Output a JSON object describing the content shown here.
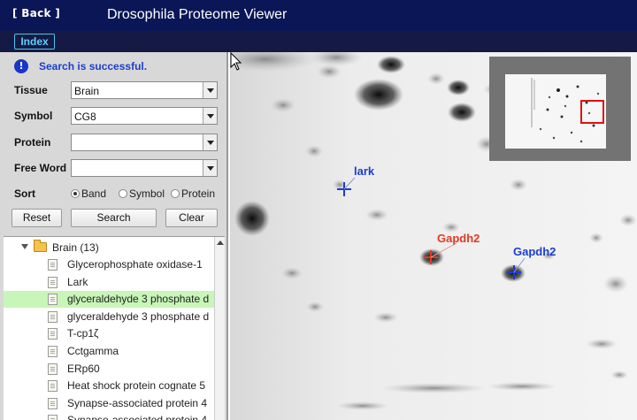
{
  "header": {
    "back_label": "[ Back ]",
    "title": "Drosophila Proteome Viewer",
    "bg_color": "#0b1656"
  },
  "subbar": {
    "index_label": "Index"
  },
  "search": {
    "status_icon": "info-icon",
    "status_text": "Search is successful.",
    "tissue_label": "Tissue",
    "tissue_value": "Brain",
    "symbol_label": "Symbol",
    "symbol_value": "CG8",
    "protein_label": "Protein",
    "protein_value": "",
    "freeword_label": "Free Word",
    "freeword_value": "",
    "sort_label": "Sort",
    "sort_options": [
      "Band",
      "Symbol",
      "Protein"
    ],
    "sort_selected": "Band",
    "reset_label": "Reset",
    "search_label": "Search",
    "clear_label": "Clear"
  },
  "tree": {
    "root_label": "Brain (13)",
    "items": [
      "Glycerophosphate oxidase-1",
      "Lark",
      "glyceraldehyde 3 phosphate d",
      "glyceraldehyde 3 phosphate d",
      "T-cp1ζ",
      "Cctgamma",
      "ERp60",
      "Heat shock protein cognate 5",
      "Synapse-associated protein 4",
      "Synapse-associated protein 4"
    ],
    "selected_index": 2,
    "selected_color": "#c8f5b8"
  },
  "gel": {
    "markers": [
      {
        "label": "lark",
        "color": "#1a3ed0"
      },
      {
        "label": "Gapdh2",
        "color": "#e03a20"
      },
      {
        "label": "Gapdh2",
        "color": "#1a3ed0"
      }
    ]
  }
}
